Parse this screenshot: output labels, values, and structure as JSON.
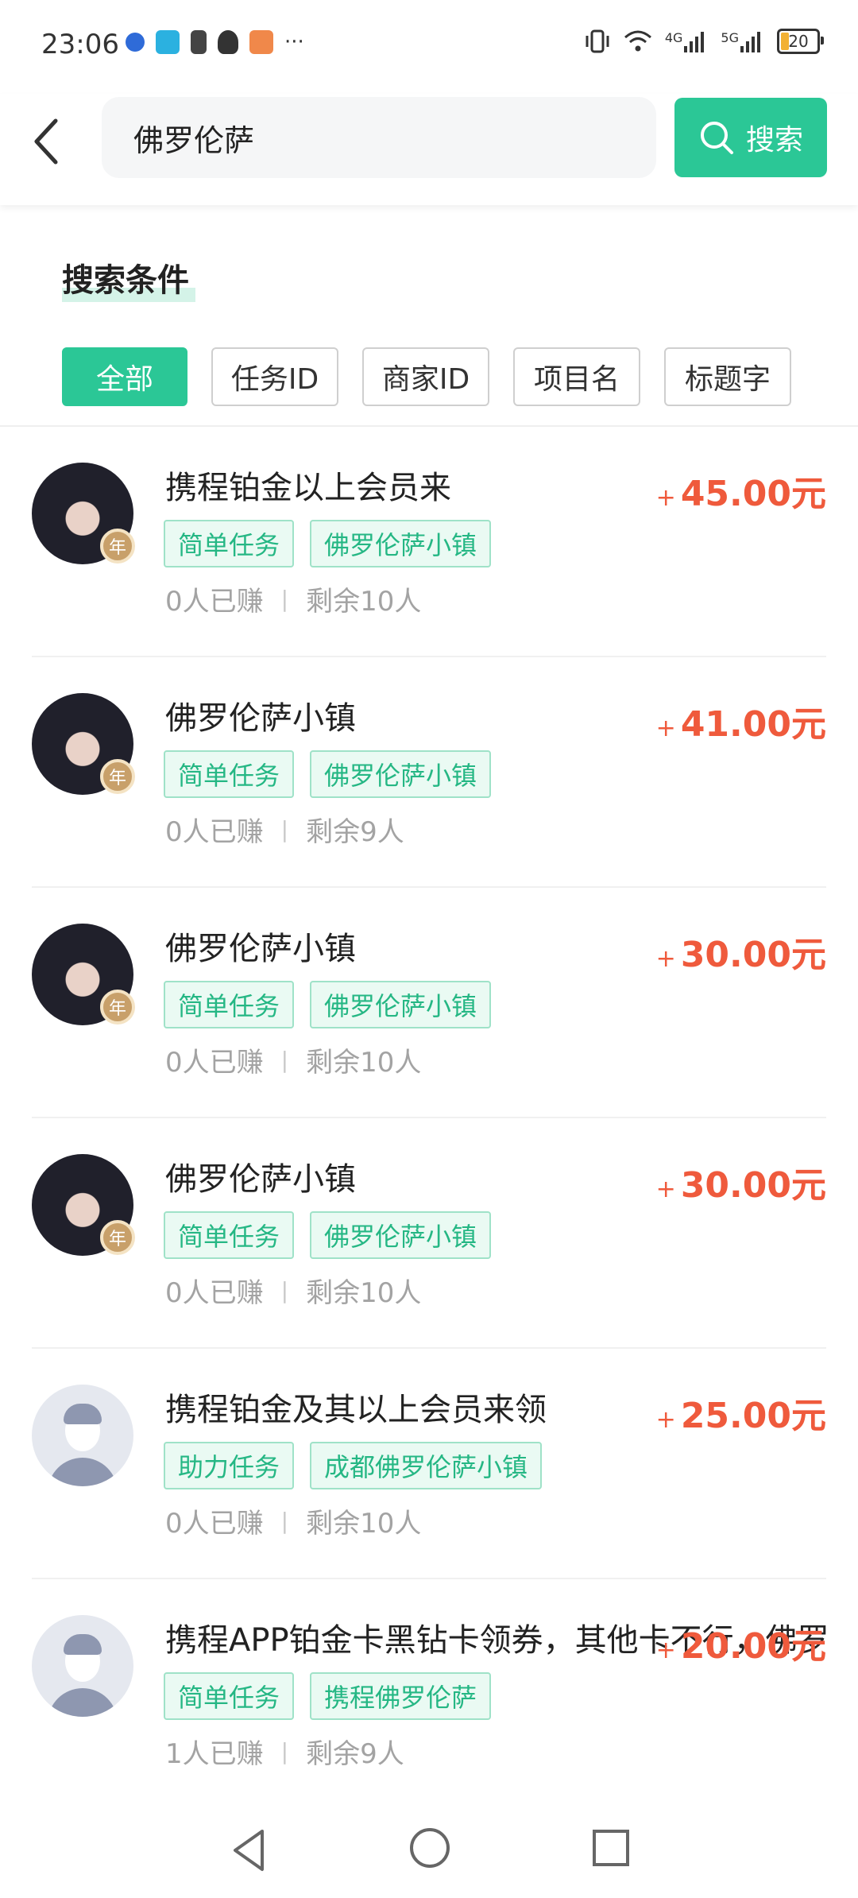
{
  "status_bar": {
    "time": "23:06",
    "battery_level": "20",
    "network_a": "4G",
    "network_b": "5G",
    "more": "···",
    "icons": [
      "app-icon-blue",
      "app-icon-yuan",
      "sim-alert-icon",
      "qq-icon",
      "app-icon-orange",
      "vibrate-icon",
      "wifi-icon",
      "signal-icon",
      "signal-icon",
      "battery-icon"
    ],
    "battery_color": "#f2b134"
  },
  "header": {
    "search_value": "佛罗伦萨",
    "search_button_label": "搜索",
    "accent_color": "#2bc796"
  },
  "conditions": {
    "title": "搜索条件",
    "filters": [
      {
        "label": "全部",
        "active": true
      },
      {
        "label": "任务ID",
        "active": false
      },
      {
        "label": "商家ID",
        "active": false
      },
      {
        "label": "项目名",
        "active": false
      },
      {
        "label": "标题字",
        "active": false
      }
    ]
  },
  "tasks": [
    {
      "title": "携程铂金以上会员来",
      "tags": [
        "简单任务",
        "佛罗伦萨小镇"
      ],
      "earned": "0人已赚",
      "remaining": "剩余10人",
      "price_prefix": "+",
      "price": "45.00元",
      "avatar": "photo",
      "badge": "年"
    },
    {
      "title": "佛罗伦萨小镇",
      "tags": [
        "简单任务",
        "佛罗伦萨小镇"
      ],
      "earned": "0人已赚",
      "remaining": "剩余9人",
      "price_prefix": "+",
      "price": "41.00元",
      "avatar": "photo",
      "badge": "年"
    },
    {
      "title": "佛罗伦萨小镇",
      "tags": [
        "简单任务",
        "佛罗伦萨小镇"
      ],
      "earned": "0人已赚",
      "remaining": "剩余10人",
      "price_prefix": "+",
      "price": "30.00元",
      "avatar": "photo",
      "badge": "年"
    },
    {
      "title": "佛罗伦萨小镇",
      "tags": [
        "简单任务",
        "佛罗伦萨小镇"
      ],
      "earned": "0人已赚",
      "remaining": "剩余10人",
      "price_prefix": "+",
      "price": "30.00元",
      "avatar": "photo",
      "badge": "年"
    },
    {
      "title": "携程铂金及其以上会员来领",
      "tags": [
        "助力任务",
        "成都佛罗伦萨小镇"
      ],
      "earned": "0人已赚",
      "remaining": "剩余10人",
      "price_prefix": "+",
      "price": "25.00元",
      "avatar": "default",
      "badge": ""
    },
    {
      "title": "携程APP铂金卡黑钻卡领券，其他卡不行，佛罗",
      "tags": [
        "简单任务",
        "携程佛罗伦萨"
      ],
      "earned": "1人已赚",
      "remaining": "剩余9人",
      "price_prefix": "+",
      "price": "20.00元",
      "avatar": "default",
      "badge": ""
    }
  ],
  "colors": {
    "price": "#ef5a3c",
    "tag_text": "#25b784"
  }
}
